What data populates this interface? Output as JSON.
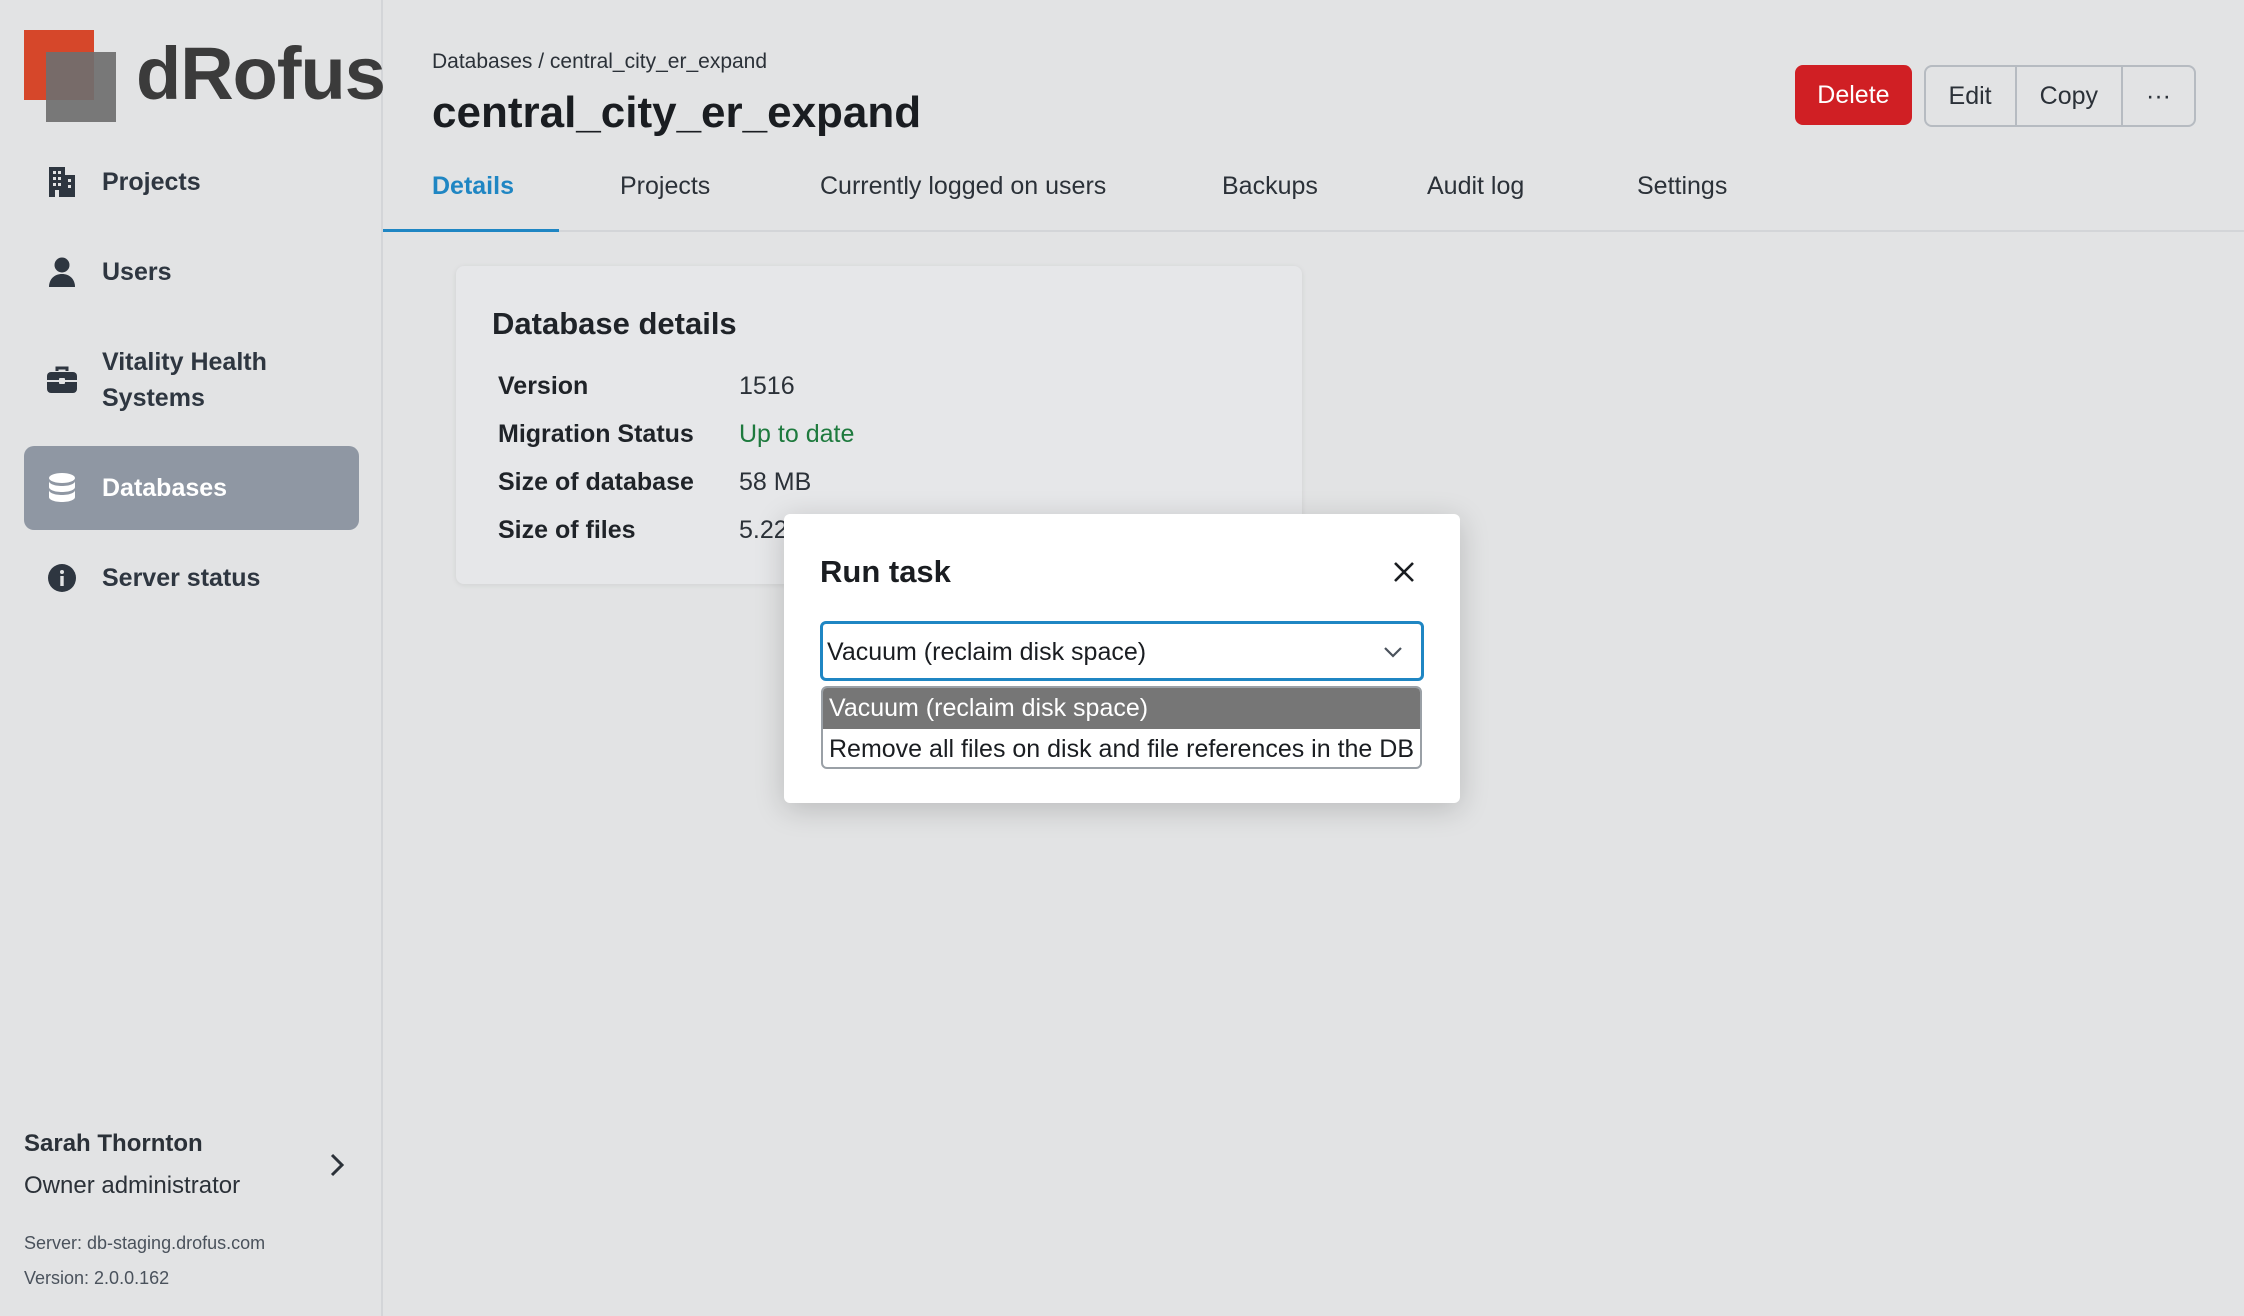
{
  "app": {
    "brand": "dRofus"
  },
  "sidebar": {
    "items": [
      {
        "label": "Projects",
        "icon": "building-icon",
        "active": false
      },
      {
        "label": "Users",
        "icon": "user-icon",
        "active": false
      },
      {
        "label": "Vitality Health Systems",
        "icon": "briefcase-icon",
        "active": false
      },
      {
        "label": "Databases",
        "icon": "database-icon",
        "active": true
      },
      {
        "label": "Server status",
        "icon": "info-icon",
        "active": false
      }
    ],
    "user": {
      "name": "Sarah Thornton",
      "role": "Owner administrator"
    },
    "server": "Server: db-staging.drofus.com",
    "version": "Version: 2.0.0.162"
  },
  "header": {
    "breadcrumb": "Databases / central_city_er_expand",
    "title": "central_city_er_expand",
    "actions": {
      "delete": "Delete",
      "edit": "Edit",
      "copy": "Copy",
      "more": "···"
    }
  },
  "tabs": [
    {
      "label": "Details",
      "active": true
    },
    {
      "label": "Projects",
      "active": false
    },
    {
      "label": "Currently logged on users",
      "active": false
    },
    {
      "label": "Backups",
      "active": false
    },
    {
      "label": "Audit log",
      "active": false
    },
    {
      "label": "Settings",
      "active": false
    }
  ],
  "details": {
    "title": "Database details",
    "rows": [
      {
        "key": "Version",
        "value": "1516"
      },
      {
        "key": "Migration Status",
        "value": "Up to date"
      },
      {
        "key": "Size of database",
        "value": "58 MB"
      },
      {
        "key": "Size of files",
        "value": "5.22"
      }
    ]
  },
  "modal": {
    "title": "Run task",
    "select_value": "Vacuum (reclaim disk space)",
    "options": [
      "Vacuum (reclaim disk space)",
      "Remove all files on disk and file references in the DB"
    ]
  },
  "colors": {
    "accent": "#1f86c3",
    "danger": "#d01f24",
    "success": "#1e7a3e",
    "sidebar_active": "#8f97a3"
  }
}
